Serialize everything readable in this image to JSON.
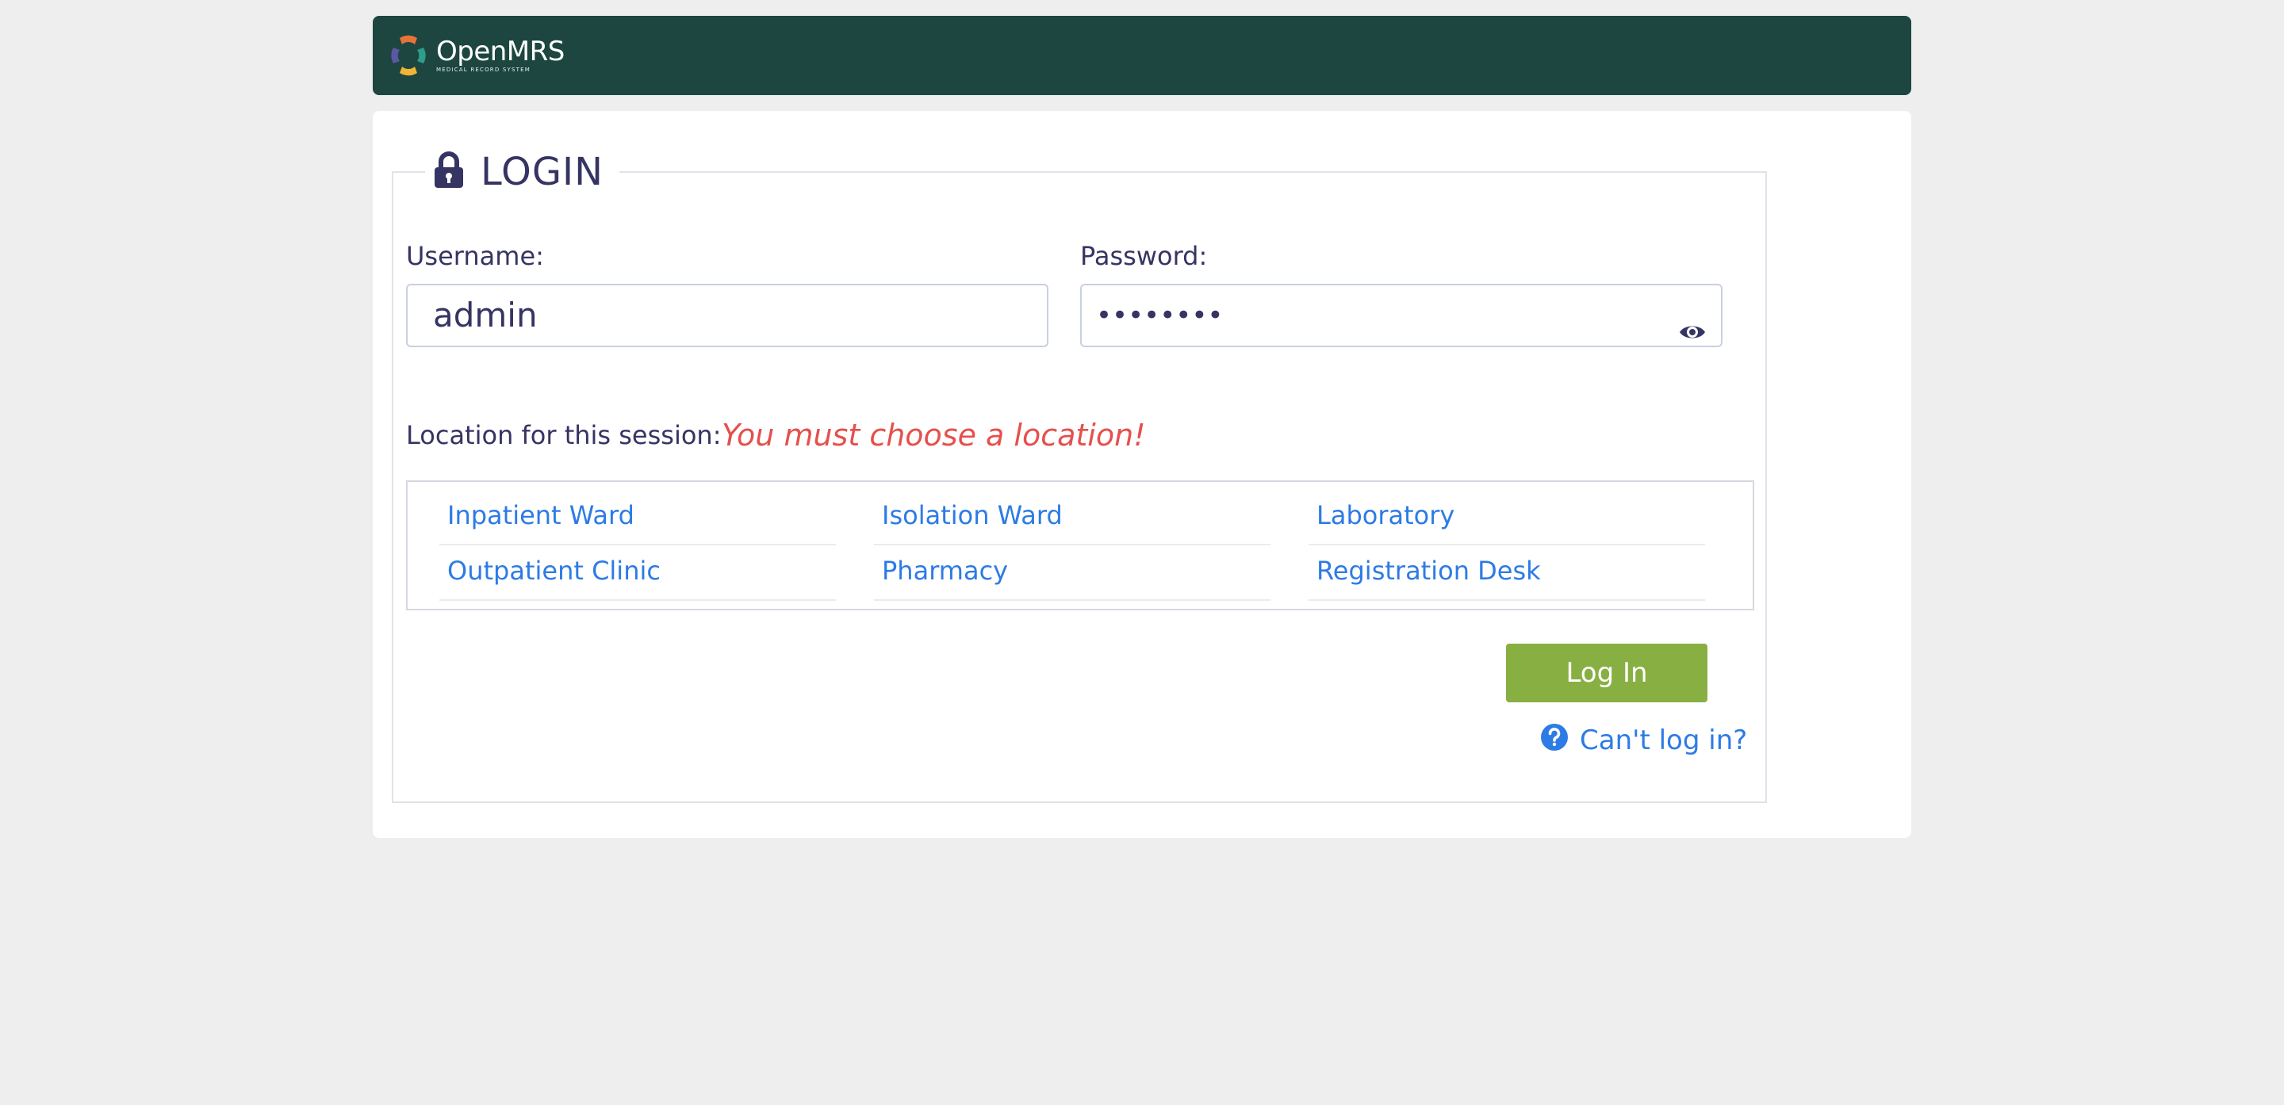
{
  "header": {
    "logo_name": "OpenMRS",
    "logo_sub": "MEDICAL RECORD SYSTEM"
  },
  "login": {
    "title": "LOGIN",
    "username_label": "Username:",
    "username_value": "admin",
    "password_label": "Password:",
    "password_value": "••••••••",
    "location_label": "Location for this session:",
    "location_error": "You must choose a location!",
    "locations": [
      "Inpatient Ward",
      "Isolation Ward",
      "Laboratory",
      "Outpatient Clinic",
      "Pharmacy",
      "Registration Desk"
    ],
    "login_button": "Log In",
    "cant_login": "Can't log in?"
  },
  "colors": {
    "header_bg": "#1c463f",
    "accent_link": "#2d7be5",
    "button": "#88af42",
    "error": "#e5504d",
    "text": "#363463"
  },
  "icons": [
    "openmrs-logo-icon",
    "lock-icon",
    "eye-icon",
    "question-circle-icon"
  ]
}
